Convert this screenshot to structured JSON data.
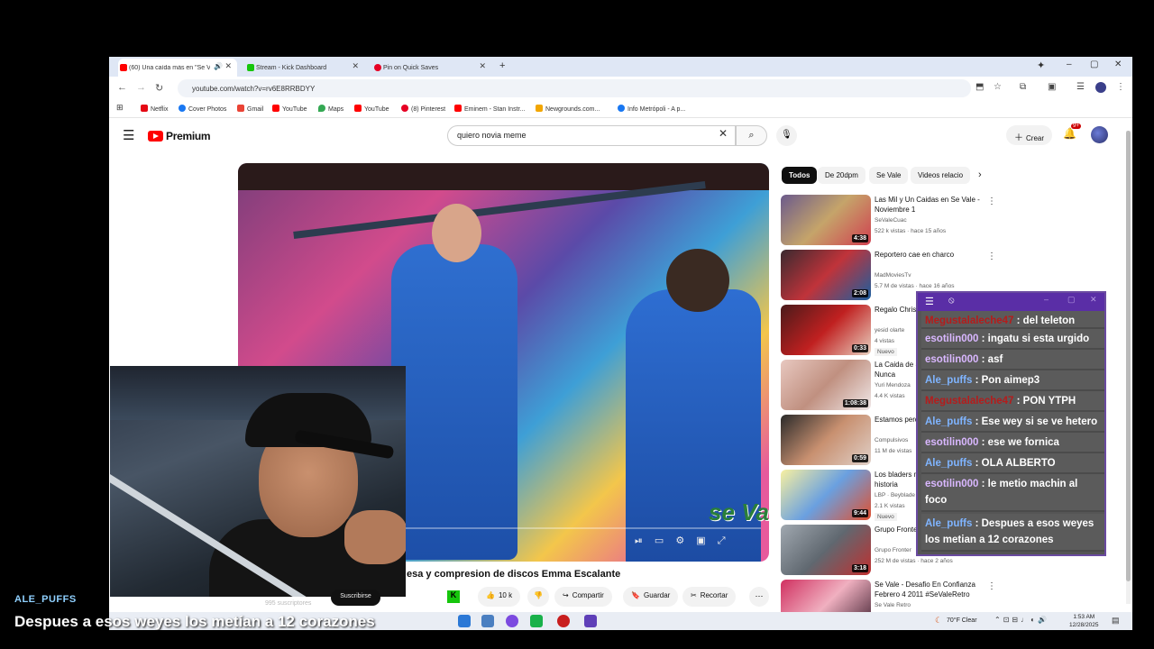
{
  "browser": {
    "tabs": [
      {
        "label": "(60) Una caída más en \"Se V",
        "favicon_color": "#ff0000",
        "active": true
      },
      {
        "label": "Stream - Kick Dashboard",
        "favicon_color": "#16c60c",
        "active": false
      },
      {
        "label": "Pin on Quick Saves",
        "favicon_color": "#e60023",
        "active": false
      }
    ],
    "new_tab": "+",
    "window_controls": {
      "minimize": "–",
      "maximize": "▢",
      "close": "✕"
    },
    "url": "youtube.com/watch?v=rv6E8RRBDYY",
    "bookmarks": [
      {
        "label": "Netflix",
        "color": "#e50914"
      },
      {
        "label": "Cover Photos",
        "color": "#1877f2"
      },
      {
        "label": "Gmail",
        "color": "#ea4335"
      },
      {
        "label": "YouTube",
        "color": "#ff0000"
      },
      {
        "label": "Maps",
        "color": "#34a853"
      },
      {
        "label": "YouTube",
        "color": "#ff0000"
      },
      {
        "label": "(8) Pinterest",
        "color": "#e60023"
      },
      {
        "label": "Eminem - Stan Instr...",
        "color": "#ff0000"
      },
      {
        "label": "Newgrounds.com...",
        "color": "#f2a600"
      },
      {
        "label": "Info Metrópoli - A p...",
        "color": "#1877f2"
      }
    ]
  },
  "youtube": {
    "logo_text": "Premium",
    "search_query": "quiero novia meme",
    "create_label": "Crear",
    "notif_badge": "9+",
    "video_title": "esa y compresion de discos Emma Escalante",
    "channel_subs": "995 suscriptores",
    "subscribe_label": "Suscribirse",
    "like_count": "10 k",
    "actions": {
      "share": "Compartir",
      "save": "Guardar",
      "clip": "Recortar"
    },
    "overlay_logo": "se Va",
    "chips": [
      "Todos",
      "De 20dpm",
      "Se Vale",
      "Videos relacio"
    ],
    "recommendations": [
      {
        "title": "Las Mil y Un Caidas en Se Vale - Noviembre 1",
        "channel": "SeValeCuac",
        "meta": "522 k vistas · hace 15 años",
        "duration": "4:38",
        "colors": [
          "#6b5a8c",
          "#c5a46a",
          "#d04050"
        ]
      },
      {
        "title": "Reportero cae en charco",
        "channel": "MadMoviesTv",
        "meta": "5.7 M de vistas · hace 16 años",
        "duration": "2:08",
        "colors": [
          "#3a2a30",
          "#c0333a",
          "#1a5fa0"
        ]
      },
      {
        "title": "Regalo Chris",
        "channel": "yesid olarte",
        "meta": "4 vistas",
        "badge": "Nuevo",
        "duration": "0:33",
        "colors": [
          "#4a1a1a",
          "#c02020",
          "#e8d0c0"
        ]
      },
      {
        "title": "La Caida de Se Vale la Historia Nunca",
        "channel": "Yuri Mendoza",
        "meta": "4.4 K vistas",
        "duration": "1:08:38",
        "colors": [
          "#e8c8c0",
          "#c09080",
          "#f0e8e8"
        ]
      },
      {
        "title": "Estamos perdi original",
        "channel": "Compulsivos",
        "meta": "11 M de vistas",
        "duration": "0:59",
        "colors": [
          "#2a2a2a",
          "#c89070",
          "#e0d0c8"
        ]
      },
      {
        "title": "Los bladers más vende de la historia",
        "channel": "LBP · Beyblade",
        "meta": "2.1 K vistas",
        "badge": "Nuevo",
        "duration": "9:44",
        "colors": [
          "#f8f0a0",
          "#6aa0e0",
          "#e05030"
        ]
      },
      {
        "title": "Grupo Fronte Registrada",
        "channel": "Grupo Fronter",
        "meta": "252 M de vistas · hace 2 años",
        "duration": "3:18",
        "colors": [
          "#a0a8b0",
          "#606870",
          "#c03030"
        ]
      },
      {
        "title": "Se Vale - Desafio En Confianza Febrero 4 2011 #SeValeRetro",
        "channel": "Se Vale Retro",
        "meta": "",
        "duration": "",
        "colors": [
          "#d03060",
          "#f0b0c0",
          "#402030"
        ]
      }
    ]
  },
  "chat": {
    "messages": [
      {
        "user": "Megustalaleche47",
        "text": " : del teleton",
        "kind": "m"
      },
      {
        "user": "esotilin000",
        "text": " : ingatu si esta urgido",
        "kind": "e"
      },
      {
        "user": "esotilin000",
        "text": " : asf",
        "kind": "e"
      },
      {
        "user": "Ale_puffs",
        "text": " : Pon aimep3",
        "kind": "a"
      },
      {
        "user": "Megustalaleche47",
        "text": " : PON YTPH",
        "kind": "m"
      },
      {
        "user": "Ale_puffs",
        "text": " : Ese wey si se ve hetero",
        "kind": "a"
      },
      {
        "user": "esotilin000",
        "text": " : ese we fornica",
        "kind": "e"
      },
      {
        "user": "Ale_puffs",
        "text": " : OLA ALBERTO",
        "kind": "a"
      },
      {
        "user": "esotilin000",
        "text": " : le metio machin al foco",
        "kind": "e"
      },
      {
        "user": "Ale_puffs",
        "text": " : Despues a esos weyes los metian a 12 corazones",
        "kind": "a"
      }
    ]
  },
  "caption": {
    "user": "ALE_PUFFS",
    "text": "Despues a esos weyes los metían a 12 corazones"
  },
  "taskbar": {
    "weather": "70°F  Clear",
    "time": "1:53 AM",
    "date": "12/28/2025"
  }
}
